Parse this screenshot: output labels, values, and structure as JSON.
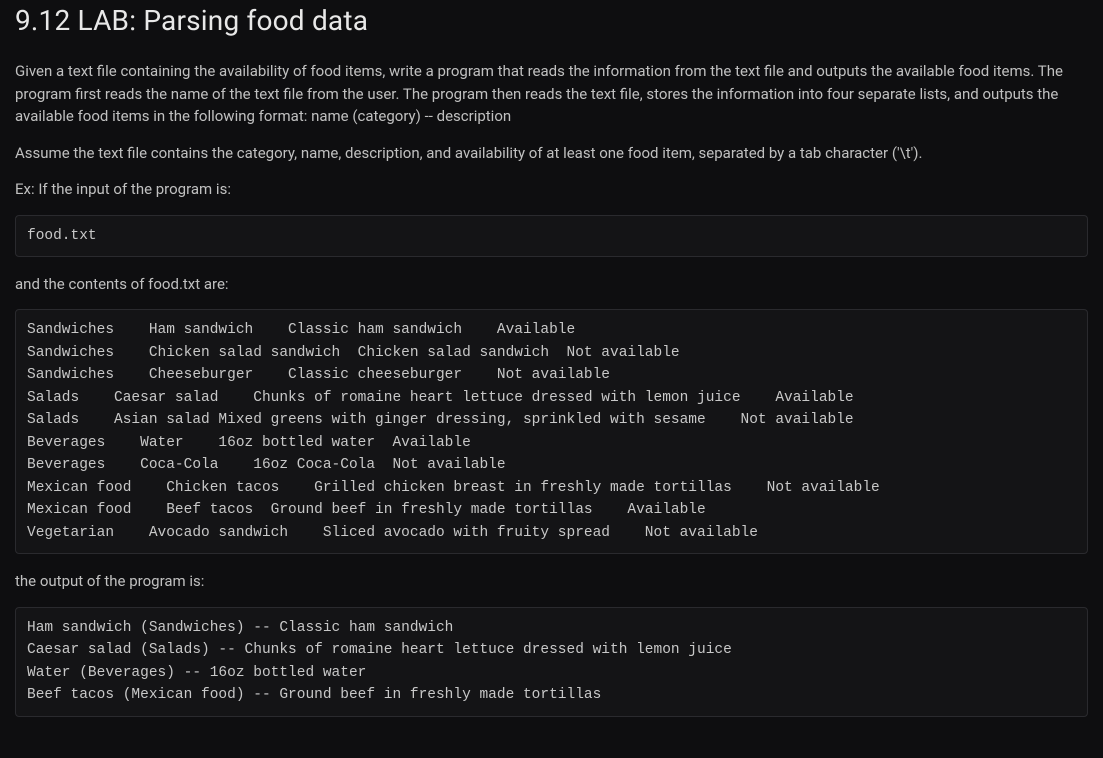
{
  "title": "9.12 LAB: Parsing food data",
  "para1": "Given a text file containing the availability of food items, write a program that reads the information from the text file and outputs the available food items. The program first reads the name of the text file from the user. The program then reads the text file, stores the information into four separate lists, and outputs the available food items in the following format: name (category) -- description",
  "para2": "Assume the text file contains the category, name, description, and availability of at least one food item, separated by a tab character ('\\t').",
  "para3": "Ex: If the input of the program is:",
  "input_code": "food.txt",
  "para4": "and the contents of food.txt are:",
  "file_contents": "Sandwiches    Ham sandwich    Classic ham sandwich    Available\nSandwiches    Chicken salad sandwich  Chicken salad sandwich  Not available\nSandwiches    Cheeseburger    Classic cheeseburger    Not available\nSalads    Caesar salad    Chunks of romaine heart lettuce dressed with lemon juice    Available\nSalads    Asian salad Mixed greens with ginger dressing, sprinkled with sesame    Not available\nBeverages    Water    16oz bottled water  Available\nBeverages    Coca-Cola    16oz Coca-Cola  Not available\nMexican food    Chicken tacos    Grilled chicken breast in freshly made tortillas    Not available\nMexican food    Beef tacos  Ground beef in freshly made tortillas    Available\nVegetarian    Avocado sandwich    Sliced avocado with fruity spread    Not available",
  "para5": "the output of the program is:",
  "output_code": "Ham sandwich (Sandwiches) -- Classic ham sandwich\nCaesar salad (Salads) -- Chunks of romaine heart lettuce dressed with lemon juice\nWater (Beverages) -- 16oz bottled water\nBeef tacos (Mexican food) -- Ground beef in freshly made tortillas"
}
